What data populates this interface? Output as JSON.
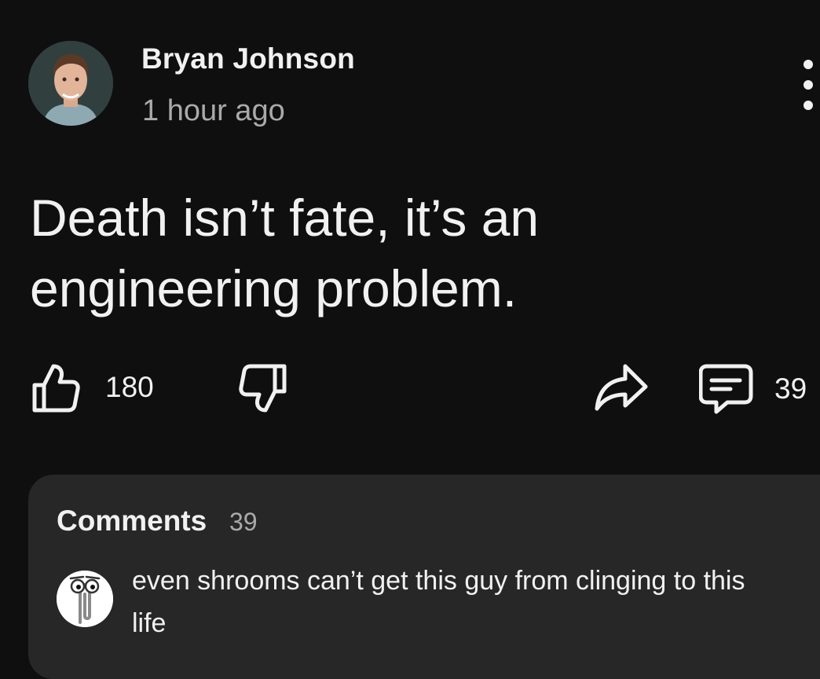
{
  "post": {
    "author": "Bryan Johnson",
    "time": "1 hour ago",
    "text": "Death isn’t fate, it’s an engineering problem."
  },
  "actions": {
    "like_count": "180",
    "comment_count": "39"
  },
  "comments": {
    "title": "Comments",
    "count": "39",
    "top_comment": "even shrooms can’t get this guy from clinging to this life"
  },
  "icons": {
    "like": "thumb-up-outline",
    "dislike": "thumb-down-outline",
    "share": "share-arrow-outline",
    "comments": "comment-bubble-outline",
    "more": "vertical-ellipsis",
    "commenter_avatar": "paperclip-character"
  },
  "colors": {
    "background": "#0f0f0f",
    "card": "#272727",
    "text": "#f1f1f1",
    "secondary_text": "#aaaaaa"
  }
}
